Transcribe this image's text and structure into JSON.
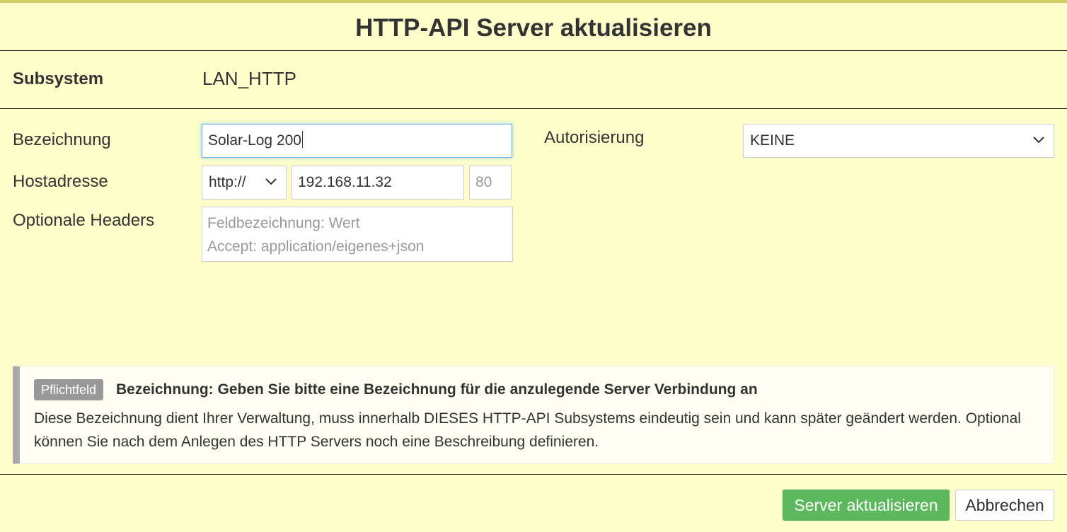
{
  "dialog": {
    "title": "HTTP-API Server aktualisieren"
  },
  "subsystem": {
    "label": "Subsystem",
    "value": "LAN_HTTP"
  },
  "form": {
    "bezeichnung": {
      "label": "Bezeichnung",
      "value": "Solar-Log 200"
    },
    "hostadresse": {
      "label": "Hostadresse",
      "protocol": "http://",
      "host": "192.168.11.32",
      "port_placeholder": "80"
    },
    "headers": {
      "label": "Optionale Headers",
      "placeholder": "Feldbezeichnung: Wert\nAccept: application/eigenes+json"
    },
    "autorisierung": {
      "label": "Autorisierung",
      "value": "KEINE"
    }
  },
  "help": {
    "badge": "Pflichtfeld",
    "title": "Bezeichnung: Geben Sie bitte eine Bezeichnung für die anzulegende Server Verbindung an",
    "text": "Diese Bezeichnung dient Ihrer Verwaltung, muss innerhalb DIESES HTTP-API Subsystems eindeutig sein und kann später geändert werden. Optional können Sie nach dem Anlegen des HTTP Servers noch eine Beschreibung definieren."
  },
  "buttons": {
    "submit": "Server aktualisieren",
    "cancel": "Abbrechen"
  },
  "icons": {
    "select_chevron": "chevron-down-icon"
  },
  "colors": {
    "background": "#ffffcc",
    "top_stripe": "#d2d060",
    "primary_button": "#5cb85c",
    "focus_border": "#66afe9",
    "badge": "#999999"
  }
}
